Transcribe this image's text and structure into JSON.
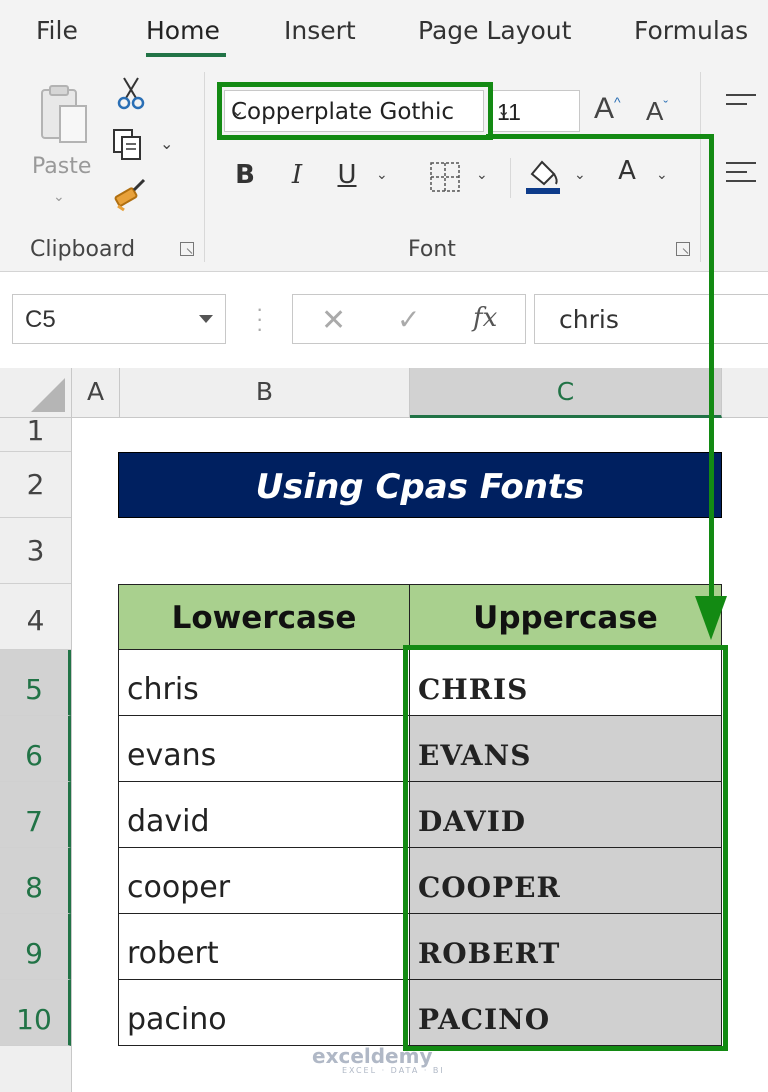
{
  "ribbon_tabs": [
    "File",
    "Home",
    "Insert",
    "Page Layout",
    "Formulas"
  ],
  "clipboard": {
    "paste_label": "Paste",
    "group_label": "Clipboard",
    "icons": [
      "paste-icon",
      "cut-icon",
      "copy-icon",
      "format-painter-icon"
    ]
  },
  "font": {
    "font_name": "Copperplate Gothic",
    "font_size": "11",
    "group_label": "Font",
    "grow_label": "A",
    "shrink_label": "A",
    "bold": "B",
    "italic": "I",
    "underline": "U",
    "font_color": "A"
  },
  "formula_bar": {
    "cell_ref": "C5",
    "fx": "fx",
    "value": "chris"
  },
  "columns": [
    "A",
    "B",
    "C"
  ],
  "rows": [
    "1",
    "2",
    "3",
    "4",
    "5",
    "6",
    "7",
    "8",
    "9",
    "10"
  ],
  "sheet": {
    "title": "Using Cpas Fonts",
    "headers": [
      "Lowercase",
      "Uppercase"
    ],
    "data": [
      {
        "lower": "chris",
        "upper": "CHRIS"
      },
      {
        "lower": "evans",
        "upper": "EVANS"
      },
      {
        "lower": "david",
        "upper": "DAVID"
      },
      {
        "lower": "cooper",
        "upper": "COOPER"
      },
      {
        "lower": "robert",
        "upper": "ROBERT"
      },
      {
        "lower": "pacino",
        "upper": "PACINO"
      }
    ]
  },
  "colors": {
    "accent_green": "#217346",
    "title_bg": "#002060",
    "header_bg": "#a9d08e",
    "annotation_green": "#138a13",
    "selection_grey": "#d0d0d0"
  },
  "watermark": {
    "brand": "exceldemy",
    "tagline": "EXCEL · DATA · BI"
  }
}
